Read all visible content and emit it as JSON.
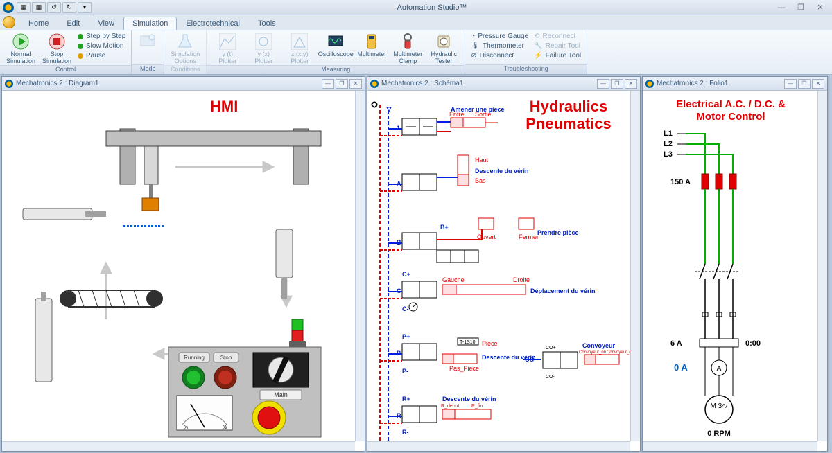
{
  "app": {
    "title": "Automation Studio™"
  },
  "tabs": {
    "items": [
      "Home",
      "Edit",
      "View",
      "Simulation",
      "Electrotechnical",
      "Tools"
    ],
    "active": 3
  },
  "ribbon": {
    "control": {
      "title": "Control",
      "normal_sim": "Normal\nSimulation",
      "stop_sim": "Stop\nSimulation",
      "step": "Step by Step",
      "slow": "Slow Motion",
      "pause": "Pause"
    },
    "mode": {
      "title": "Mode"
    },
    "conditions": {
      "title": "Conditions",
      "sim_opt": "Simulation\nOptions"
    },
    "measuring": {
      "title": "Measuring",
      "yt": "y (t)\nPlotter",
      "yx": "y (x)\nPlotter",
      "zxy": "z (x,y)\nPlotter",
      "oscilloscope": "Oscilloscope",
      "multimeter": "Multimeter",
      "clamp": "Multimeter\nClamp",
      "tester": "Hydraulic\nTester"
    },
    "troubleshooting": {
      "title": "Troubleshooting",
      "pressure": "Pressure Gauge",
      "thermo": "Thermometer",
      "disconnect": "Disconnect",
      "reconnect": "Reconnect",
      "repair": "Repair Tool",
      "failure": "Failure Tool"
    }
  },
  "panes": {
    "p1": {
      "title": "Mechatronics 2 : Diagram1",
      "heading": "HMI",
      "buttons": {
        "running": "Running",
        "stop": "Stop",
        "main": "Main",
        "estop": "EMERGENCY STOP"
      }
    },
    "p2": {
      "title": "Mechatronics 2 : Schéma1",
      "heading1": "Hydraulics",
      "heading2": "Pneumatics",
      "labels": {
        "amener": "Amener une piece",
        "entre": "Entre",
        "sortie": "Sortie",
        "haut": "Haut",
        "descente": "Descente du vérin",
        "bas": "Bas",
        "prendre": "Prendre pièce",
        "ouvert": "Ouvert",
        "fermer": "Fermer",
        "gauche": "Gauche",
        "droite": "Droite",
        "deplacement": "Déplacement du vérin",
        "piece": "Piece",
        "pas_piece": "Pas_Piece",
        "rdebut": "R_debut",
        "rfin": "R_fin",
        "convoyeur": "Convoyeur",
        "conv_on": "Convoyeur_on",
        "conv_off": "Convoyeur_off",
        "s1": "1",
        "sA": "A",
        "sB": "B",
        "sC": "C",
        "sP": "P",
        "sR": "R",
        "sCO": "CO",
        "bplus": "B+",
        "cplus": "C+",
        "cminus": "C-",
        "pplus": "P+",
        "pminus": "P-",
        "rplus": "R+",
        "rminus": "R-",
        "coplus": "CO+",
        "cominus": "CO-",
        "t1s10": "T-1S10"
      }
    },
    "p3": {
      "title": "Mechatronics 2 : Folio1",
      "heading1": "Electrical A.C. / D.C. &",
      "heading2": "Motor Control",
      "labels": {
        "L1": "L1",
        "L2": "L2",
        "L3": "L3",
        "fuse": "150 A",
        "breaker": "6 A",
        "timer": "0:00",
        "amps": "0 A",
        "ammeter": "A",
        "motor": "M\n3∿",
        "rpm": "0 RPM"
      }
    }
  }
}
